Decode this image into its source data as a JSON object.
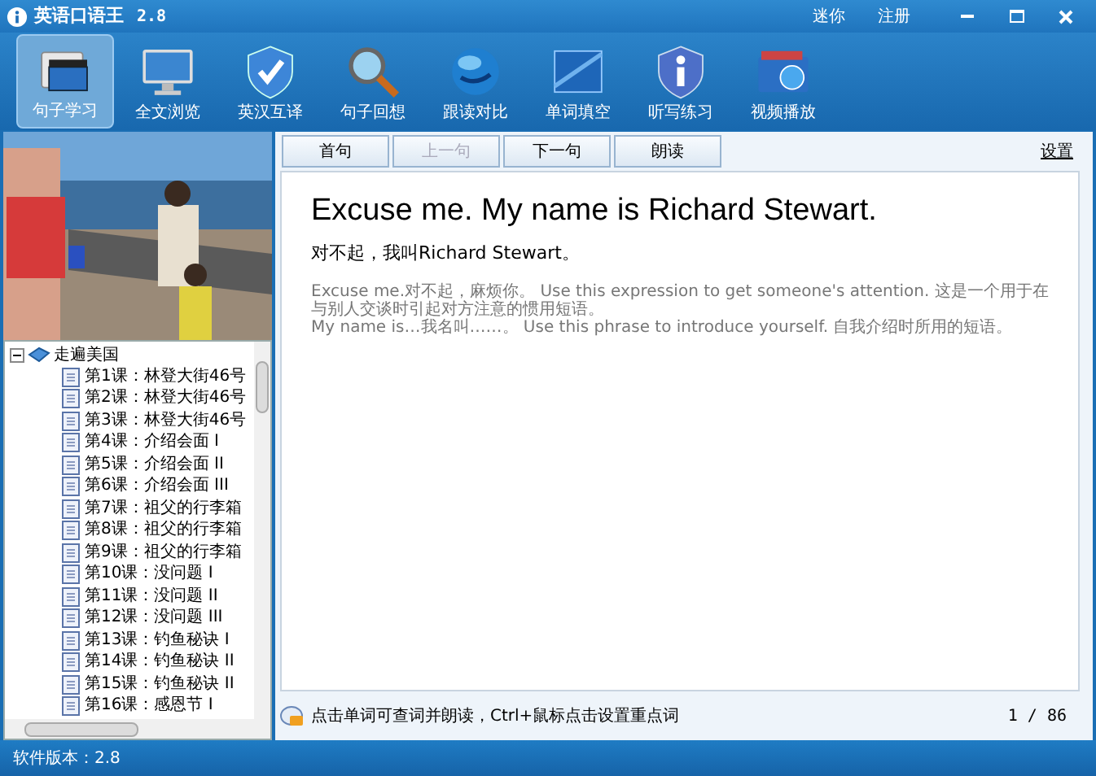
{
  "window": {
    "title": "英语口语王",
    "version": "2.8",
    "links": [
      "迷你",
      "注册"
    ]
  },
  "toolbar": [
    {
      "label": "句子学习",
      "selected": true
    },
    {
      "label": "全文浏览",
      "selected": false
    },
    {
      "label": "英汉互译",
      "selected": false
    },
    {
      "label": "句子回想",
      "selected": false
    },
    {
      "label": "跟读对比",
      "selected": false
    },
    {
      "label": "单词填空",
      "selected": false
    },
    {
      "label": "听写练习",
      "selected": false
    },
    {
      "label": "视频播放",
      "selected": false
    }
  ],
  "tree": {
    "label": "走遍美国",
    "expanded": true,
    "children": [
      {
        "label": "第1课：林登大街46号",
        "selected": false
      },
      {
        "label": "第2课：林登大街46号",
        "selected": false
      },
      {
        "label": "第3课：林登大街46号",
        "selected": false
      },
      {
        "label": "第4课：介绍会面 I",
        "selected": false
      },
      {
        "label": "第5课：介绍会面 II",
        "selected": false
      },
      {
        "label": "第6课：介绍会面 III",
        "selected": false
      },
      {
        "label": "第7课：祖父的行李箱",
        "selected": false
      },
      {
        "label": "第8课：祖父的行李箱",
        "selected": false
      },
      {
        "label": "第9课：祖父的行李箱",
        "selected": false
      },
      {
        "label": "第10课：没问题 I",
        "selected": false
      },
      {
        "label": "第11课：没问题 II",
        "selected": false
      },
      {
        "label": "第12课：没问题 III",
        "selected": false
      },
      {
        "label": "第13课：钓鱼秘诀 I",
        "selected": false
      },
      {
        "label": "第14课：钓鱼秘诀 II",
        "selected": false
      },
      {
        "label": "第15课：钓鱼秘诀 II",
        "selected": false
      },
      {
        "label": "第16课：感恩节 I",
        "selected": false
      }
    ]
  },
  "nav_buttons": [
    {
      "label": "首句",
      "disabled": false
    },
    {
      "label": "上一句",
      "disabled": true
    },
    {
      "label": "下一句",
      "disabled": false
    },
    {
      "label": "朗读",
      "disabled": false
    }
  ],
  "settings_link": "设置",
  "sentence": {
    "english": "Excuse me. My name is Richard Stewart.",
    "chinese": "对不起，我叫Richard Stewart。",
    "notes": [
      "Excuse me.对不起，麻烦你。 Use this expression to get someone's attention. 这是一个用于在与别人交谈时引起对方注意的惯用短语。",
      "My name is…我名叫……。 Use this phrase to introduce yourself. 自我介绍时所用的短语。"
    ]
  },
  "hint": "点击单词可查词并朗读，Ctrl+鼠标点击设置重点词",
  "counter": "1 / 86",
  "status_bar": "软件版本：2.8"
}
